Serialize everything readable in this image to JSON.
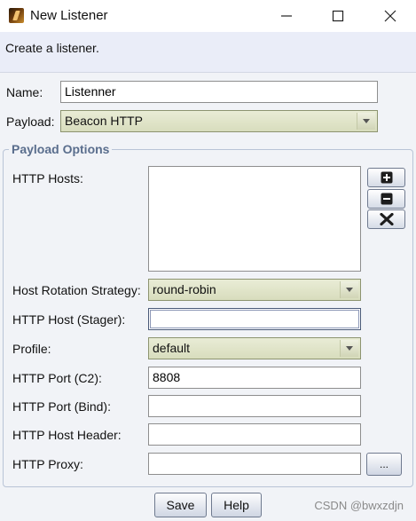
{
  "window": {
    "title": "New Listener",
    "minimize_glyph": "—",
    "maximize_glyph": "☐",
    "close_glyph": "✕"
  },
  "banner": {
    "text": "Create a listener."
  },
  "form": {
    "name_label": "Name:",
    "name_value": "Listenner",
    "payload_label": "Payload:",
    "payload_value": "Beacon HTTP"
  },
  "payload_options": {
    "title": "Payload Options",
    "http_hosts_label": "HTTP Hosts:",
    "add_icon": "plus-icon",
    "remove_icon": "minus-icon",
    "clear_icon": "x-icon",
    "host_rotation_label": "Host Rotation Strategy:",
    "host_rotation_value": "round-robin",
    "http_host_stager_label": "HTTP Host (Stager):",
    "http_host_stager_value": "",
    "profile_label": "Profile:",
    "profile_value": "default",
    "http_port_c2_label": "HTTP Port (C2):",
    "http_port_c2_value": "8808",
    "http_port_bind_label": "HTTP Port (Bind):",
    "http_port_bind_value": "",
    "http_host_header_label": "HTTP Host Header:",
    "http_host_header_value": "",
    "http_proxy_label": "HTTP Proxy:",
    "http_proxy_value": "",
    "proxy_button_label": "..."
  },
  "buttons": {
    "save": "Save",
    "help": "Help"
  },
  "watermark": "CSDN @bwxzdjn",
  "colors": {
    "group_title": "#5a6e8d",
    "combo_bg": "#dde1c4",
    "banner_bg": "#eaedf8"
  }
}
